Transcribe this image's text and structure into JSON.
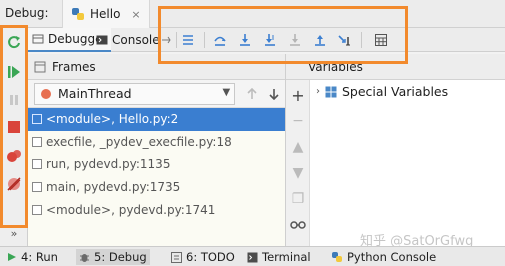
{
  "titlebar": {
    "label": "Debug:",
    "tab_name": "Hello",
    "tab_close": "×"
  },
  "tabs": {
    "debugger": "Debugger",
    "console": "Console"
  },
  "frames": {
    "header": "Frames",
    "thread": "MainThread",
    "items": [
      "<module>, Hello.py:2",
      "execfile, _pydev_execfile.py:18",
      "run, pydevd.py:1135",
      "main, pydevd.py:1735",
      "<module>, pydevd.py:1741"
    ]
  },
  "variables": {
    "header": "Variables",
    "special": "Special Variables"
  },
  "bottom": {
    "run": "4: Run",
    "debug": "5: Debug",
    "todo": "6: TODO",
    "terminal": "Terminal",
    "python_console": "Python Console"
  },
  "watermark": "知乎 @SatOrGfwg",
  "colors": {
    "accent_orange": "#f28a2d",
    "selection_blue": "#3a7ed0",
    "icon_blue": "#3c7fd1",
    "run_green": "#3aa655",
    "stop_red": "#d9443b"
  }
}
